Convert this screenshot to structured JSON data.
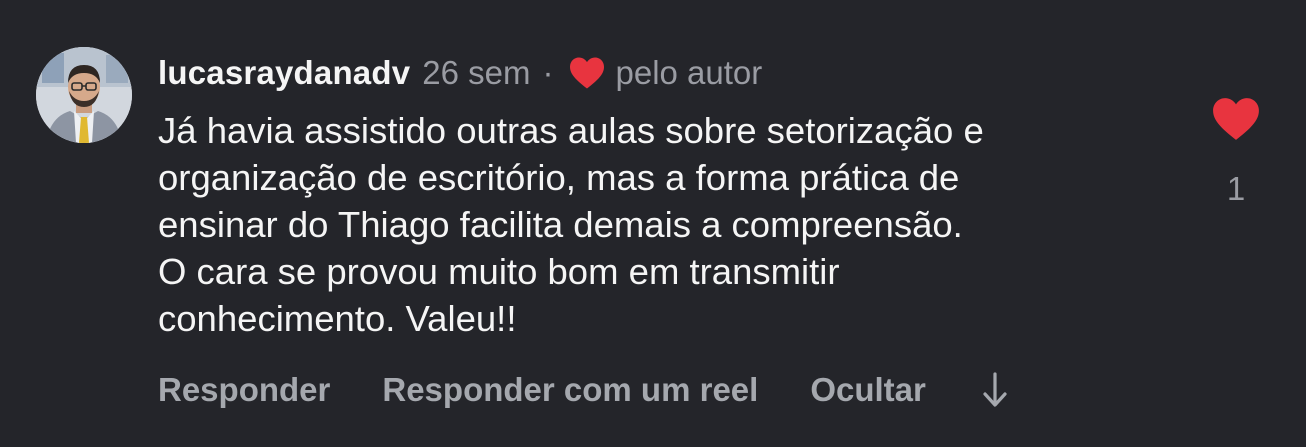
{
  "comment": {
    "username": "lucasraydanadv",
    "timestamp": "26 sem",
    "separator": "·",
    "author_label": "pelo autor",
    "author_heart_icon": "heart-icon",
    "body_lines": [
      "Já havia assistido outras aulas sobre setorização e",
      "organização de escritório, mas a forma prática de",
      "ensinar do Thiago facilita demais a compreensão.",
      "O cara se provou muito bom em transmitir",
      "conhecimento. Valeu!!"
    ],
    "like_count": "1",
    "like_icon": "heart-icon",
    "like_color": "#e8343f"
  },
  "actions": {
    "reply": "Responder",
    "reply_reel": "Responder com um reel",
    "hide": "Ocultar",
    "more_icon": "arrow-down-icon"
  }
}
